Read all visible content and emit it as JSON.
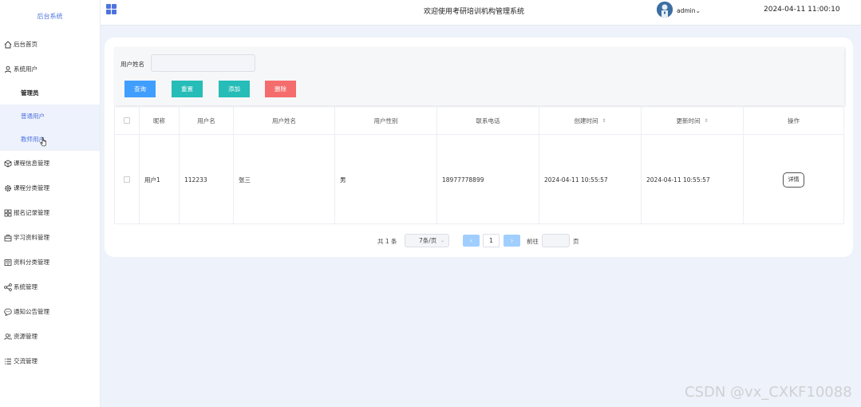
{
  "brand": "后台系统",
  "header": {
    "title": "欢迎使用考研培训机构管理系统",
    "user": "admin",
    "user_chevron": "⌄",
    "datetime": "2024-04-11 11:00:10"
  },
  "sidebar": {
    "home": "后台首页",
    "system_user": "系统用户",
    "sub": [
      "管理员",
      "普通用户",
      "教师用户"
    ],
    "items": [
      "课程信息管理",
      "课程分类管理",
      "报名记录管理",
      "学习资料管理",
      "资料分类管理",
      "系统管理",
      "通知公告管理",
      "资源管理",
      "交流管理"
    ]
  },
  "search": {
    "label": "用户姓名",
    "value": "",
    "placeholder": ""
  },
  "buttons": {
    "query": "查询",
    "reset": "重置",
    "add": "添加",
    "delete": "删除"
  },
  "table": {
    "columns": [
      "昵称",
      "用户名",
      "用户姓名",
      "用户性别",
      "联系电话",
      "创建时间",
      "更新时间",
      "操作"
    ],
    "sort_icon": "⇕",
    "rows": [
      {
        "nickname": "用户1",
        "username": "112233",
        "realname": "张三",
        "gender": "男",
        "phone": "18977778899",
        "created": "2024-04-11 10:55:57",
        "updated": "2024-04-11 10:55:57",
        "action": "详情"
      }
    ]
  },
  "pagination": {
    "total": "共 1 条",
    "page_size": "7条/页",
    "prev": "‹",
    "next": "›",
    "current": "1",
    "goto_label": "前往",
    "goto_value": "",
    "page_suffix": "页"
  },
  "watermark": "CSDN @vx_CXKF10088",
  "colors": {
    "primary": "#409eff",
    "teal": "#26bcb7",
    "danger": "#f56c6c",
    "brand": "#4e73df"
  }
}
